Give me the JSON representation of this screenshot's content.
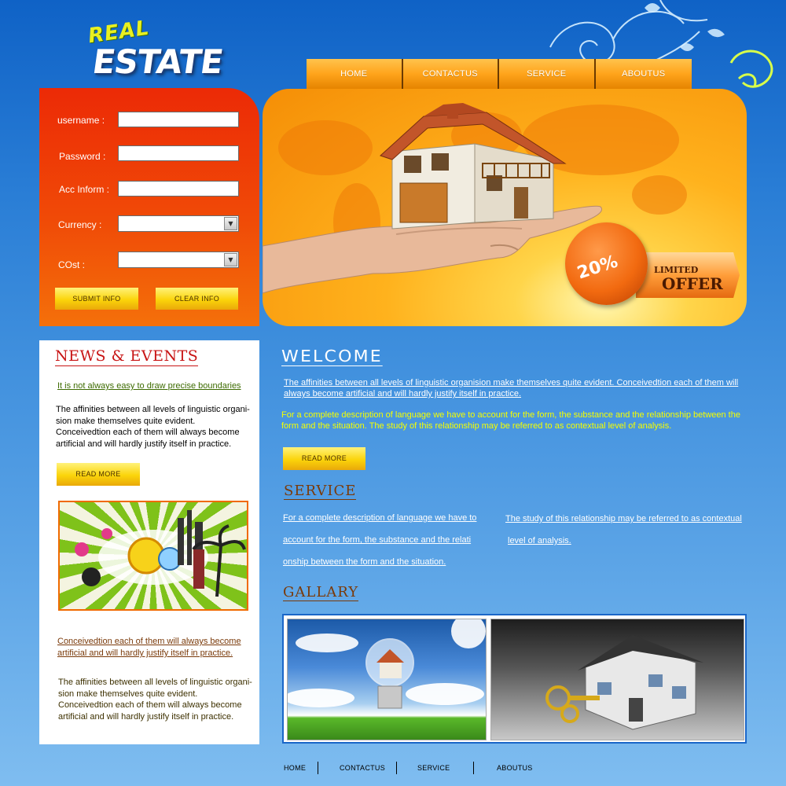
{
  "logo": {
    "top_word": "REAL",
    "main_word": "ESTATE"
  },
  "nav": {
    "items": [
      "HOME",
      "CONTACTUS",
      "SERVICE",
      "ABOUTUS"
    ]
  },
  "login": {
    "username_label": "username :",
    "password_label": "Password :",
    "acc_label": "Acc Inform :",
    "currency_label": "Currency :",
    "cost_label": "COst :",
    "submit_label": "SUBMIT INFO",
    "clear_label": "CLEAR INFO"
  },
  "banner": {
    "discount": "20%",
    "limited": "LIMITED",
    "offer": "OFFER"
  },
  "news": {
    "title": "NEWS & EVENTS",
    "link1": "It is not always easy to draw precise  boundaries",
    "text1": "The affinities between all levels of linguistic organi-sion make themselves quite evident. Conceivedtion each of them will always become artificial and will hardly justify itself in practice.",
    "read_more": "READ MORE",
    "link2": "Conceivedtion each of them will always become artificial and will hardly justify itself in practice.",
    "text2": "The affinities between all levels of linguistic organi-sion make themselves quite evident. Conceivedtion each of them will always become artificial and will hardly justify itself in practice."
  },
  "welcome": {
    "title": "WELCOME",
    "link": "The affinities between all levels of linguistic organision make themselves quite evident. Conceivedtion each of them will always become artificial and will hardly justify itself in practice.",
    "text": "For a complete description of language we have to account for the form, the substance and the relationship between the form and the situation. The study of this relationship may be referred to as contextual level of analysis.",
    "read_more": "READ MORE"
  },
  "service": {
    "title": "SERVICE",
    "col1_line1": "For a complete description of language we have to",
    "col1_line2": "account for the form, the substance and the relati",
    "col1_line3": "onship between the form and the situation.",
    "col2_line1": "The study of this relationship may be referred to as contextual",
    "col2_line2": "level of analysis."
  },
  "gallery": {
    "title": "GALLARY"
  },
  "footer_nav": {
    "items": [
      "HOME",
      "CONTACTUS",
      "SERVICE",
      "ABOUTUS"
    ]
  },
  "colors": {
    "accent_orange": "#ffa41b",
    "login_red": "#ec2a06",
    "news_title_red": "#c81414",
    "welcome_text_yellow": "#f5ff00",
    "section_brown": "#7a3a0a"
  }
}
